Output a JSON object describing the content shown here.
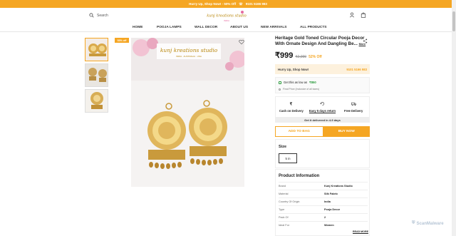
{
  "topbar": {
    "text": "Hurry Up, Shop Now! - 50% Off",
    "phone": "9101 5166 983"
  },
  "header": {
    "search_placeholder": "Search",
    "logo_text": "kunj kreations studio",
    "logo_sub": "INDIA"
  },
  "nav": {
    "items": [
      "HOME",
      "POOJA LAMPS",
      "WALL DECOR",
      "ABOUT US",
      "NEW ARRIVALS",
      "ALL PRODUCTS"
    ]
  },
  "gallery": {
    "badge": "53% off",
    "image_logo": "kunj kreations studio",
    "image_sub": "INDIA · AUSTRALIA · USA"
  },
  "product": {
    "title": "Heritage Gold Toned Circular Pooja Decor With Ornate Design And Dangling Be...",
    "more": "More",
    "price": "₹999",
    "mrp": "₹2,099",
    "discount": "52% Off"
  },
  "hurry": {
    "left": "Hurry Up, Shop Now!",
    "right": "9101 5166 983"
  },
  "offers": {
    "best_price_prefix": "Get this as low as",
    "best_price": "₹850",
    "tax_note": "Final Price (Inclusive of all taxes)"
  },
  "features": [
    {
      "label": "Cash on Delivery",
      "icon": "rupee-icon"
    },
    {
      "label": "Easy 5 days return",
      "icon": "return-icon"
    },
    {
      "label": "Free Delivery",
      "icon": "truck-icon"
    }
  ],
  "delivery_note": "Get it delivered in 4-9 days",
  "buttons": {
    "add_to_bag": "ADD TO BAG",
    "buy_now": "BUY NOW"
  },
  "size": {
    "label": "Size",
    "selected": "5 in"
  },
  "product_info": {
    "title": "Product Information",
    "rows": [
      {
        "k": "Brand",
        "v": "Kunj Kreations Studio"
      },
      {
        "k": "Material",
        "v": "Silk Fabric"
      },
      {
        "k": "Country Of Origin",
        "v": "India"
      },
      {
        "k": "Type",
        "v": "Pooja Decor"
      },
      {
        "k": "Pack Of",
        "v": "2"
      },
      {
        "k": "Ideal For",
        "v": "Women"
      }
    ],
    "read_more": "READ MORE"
  },
  "watermark": "ScanMalware",
  "colors": {
    "accent": "#f5a623",
    "green": "#2a9a3c"
  }
}
